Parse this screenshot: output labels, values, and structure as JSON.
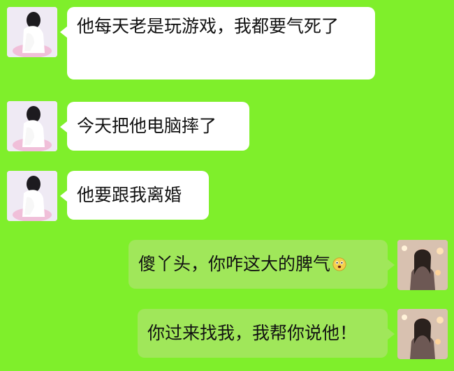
{
  "messages": [
    {
      "side": "left",
      "text": "他每天老是玩游戏，我都要气死了"
    },
    {
      "side": "left",
      "text": "今天把他电脑摔了"
    },
    {
      "side": "left",
      "text": "他要跟我离婚"
    },
    {
      "side": "right",
      "text": "傻丫头，你咋这大的脾气",
      "emoji": "astonished-face-icon"
    },
    {
      "side": "right",
      "text": "你过来找我，我帮你说他！"
    }
  ],
  "colors": {
    "background": "#7fef2b",
    "incoming_bubble": "#ffffff",
    "outgoing_bubble": "#a0e75a"
  }
}
